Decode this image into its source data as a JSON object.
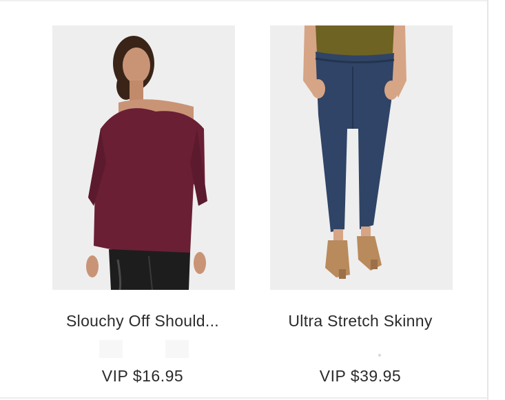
{
  "products": [
    {
      "name": "Slouchy Off Should...",
      "price": "VIP $16.95",
      "image_icon": "product-photo-icon",
      "colors": {
        "top": "#6a1f35",
        "pants": "#1d1d1d",
        "skin": "#c99476",
        "hair": "#3a2418"
      }
    },
    {
      "name": "Ultra Stretch Skinny",
      "price": "VIP $39.95",
      "image_icon": "product-photo-icon",
      "colors": {
        "top": "#6e6322",
        "denim": "#2f4466",
        "skin": "#d6a585",
        "shoe": "#b98a5c"
      }
    }
  ]
}
